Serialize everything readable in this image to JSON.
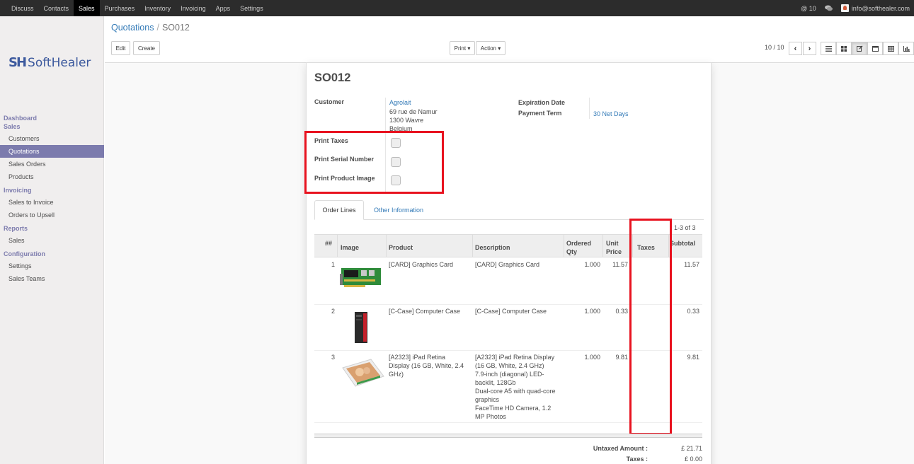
{
  "topbar": {
    "menu": [
      "Discuss",
      "Contacts",
      "Sales",
      "Purchases",
      "Inventory",
      "Invoicing",
      "Apps",
      "Settings"
    ],
    "active_menu": "Sales",
    "messages_count": "10",
    "user_email": "info@softhealer.com"
  },
  "sidebar": {
    "logo_mark": "SH",
    "logo_text": "SoftHealer",
    "sections": [
      {
        "label": "Dashboard",
        "items": []
      },
      {
        "label": "Sales",
        "items": [
          "Customers",
          "Quotations",
          "Sales Orders",
          "Products"
        ]
      },
      {
        "label": "Invoicing",
        "items": [
          "Sales to Invoice",
          "Orders to Upsell"
        ]
      },
      {
        "label": "Reports",
        "items": [
          "Sales"
        ]
      },
      {
        "label": "Configuration",
        "items": [
          "Settings",
          "Sales Teams"
        ]
      }
    ],
    "active_item": "Quotations"
  },
  "breadcrumb": {
    "parent": "Quotations",
    "current": "SO012"
  },
  "toolbar": {
    "edit": "Edit",
    "create": "Create",
    "print": "Print ▾",
    "action": "Action ▾",
    "pager": "10 / 10"
  },
  "form": {
    "title": "SO012",
    "customer_label": "Customer",
    "customer_name": "Agrolait",
    "customer_address": [
      "69 rue de Namur",
      "1300 Wavre",
      "Belgium"
    ],
    "expiration_label": "Expiration Date",
    "payment_term_label": "Payment Term",
    "payment_term_value": "30 Net Days",
    "print_taxes_label": "Print Taxes",
    "print_serial_label": "Print Serial Number",
    "print_image_label": "Print Product Image"
  },
  "tabs": {
    "order_lines": "Order Lines",
    "other_info": "Other Information"
  },
  "table": {
    "record_count": "1-3 of 3",
    "headers": {
      "num": "##",
      "image": "Image",
      "product": "Product",
      "description": "Description",
      "qty": [
        "Ordered",
        "Qty"
      ],
      "price": [
        "Unit",
        "Price"
      ],
      "taxes": "Taxes",
      "subtotal": "Subtotal"
    },
    "rows": [
      {
        "num": "1",
        "image": "graphics-card-image",
        "product": [
          "[CARD] Graphics Card"
        ],
        "description": [
          "[CARD] Graphics Card"
        ],
        "qty": "1.000",
        "price": "11.57",
        "taxes": "",
        "subtotal": "11.57"
      },
      {
        "num": "2",
        "image": "computer-case-image",
        "product": [
          "[C-Case] Computer Case"
        ],
        "description": [
          "[C-Case] Computer Case"
        ],
        "qty": "1.000",
        "price": "0.33",
        "taxes": "",
        "subtotal": "0.33"
      },
      {
        "num": "3",
        "image": "ipad-display-image",
        "product": [
          "[A2323] iPad Retina",
          "Display (16 GB, White, 2.4",
          "GHz)"
        ],
        "description": [
          "[A2323] iPad Retina Display",
          "(16 GB, White, 2.4 GHz)",
          "7.9-inch (diagonal) LED-",
          "backlit, 128Gb",
          "Dual-core A5 with quad-core",
          "graphics",
          "FaceTime HD Camera, 1.2",
          "MP Photos"
        ],
        "qty": "1.000",
        "price": "9.81",
        "taxes": "",
        "subtotal": "9.81"
      }
    ]
  },
  "totals": {
    "untaxed_label": "Untaxed Amount :",
    "untaxed_value": "£ 21.71",
    "taxes_label": "Taxes :",
    "taxes_value": "£ 0.00"
  },
  "colors": {
    "brand": "#7c7bad",
    "link": "#337ab7",
    "highlight": "#e8121f"
  }
}
